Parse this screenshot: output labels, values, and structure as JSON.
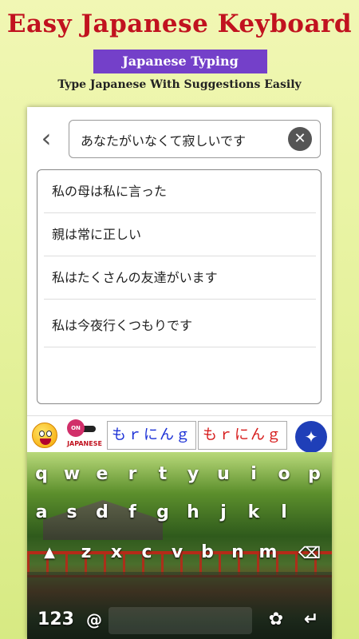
{
  "promo": {
    "title": "Easy Japanese Keyboard",
    "badge": "Japanese Typing",
    "subtitle": "Type Japanese With Suggestions Easily"
  },
  "search": {
    "value": "あなたがいなくて寂しいです"
  },
  "suggestions": [
    "私の母は私に言った",
    "親は常に正しい",
    "私はたくさんの友達がいます",
    "私は今夜行くつもりです"
  ],
  "toolbar": {
    "toggle_state": "ON",
    "toggle_label": "JAPANESE",
    "candidate_1": "もｒにんｇ",
    "candidate_2": "もｒにんｇ",
    "candidate_1_color": "#1a2fd6",
    "candidate_2_color": "#d61a1a"
  },
  "keyboard": {
    "row1": [
      "q",
      "w",
      "e",
      "r",
      "t",
      "y",
      "u",
      "i",
      "o",
      "p"
    ],
    "row2": [
      "a",
      "s",
      "d",
      "f",
      "g",
      "h",
      "j",
      "k",
      "l"
    ],
    "row3": [
      "z",
      "x",
      "c",
      "v",
      "b",
      "n",
      "m"
    ],
    "shift": "▲",
    "backspace": "⌫",
    "numbers": "123",
    "at": "@",
    "flower": "✿",
    "enter": "↵"
  },
  "icons": {
    "back": "chevron-left-icon",
    "clear": "close-icon",
    "emoji": "smiley-icon",
    "magic": "magic-wand-icon"
  }
}
